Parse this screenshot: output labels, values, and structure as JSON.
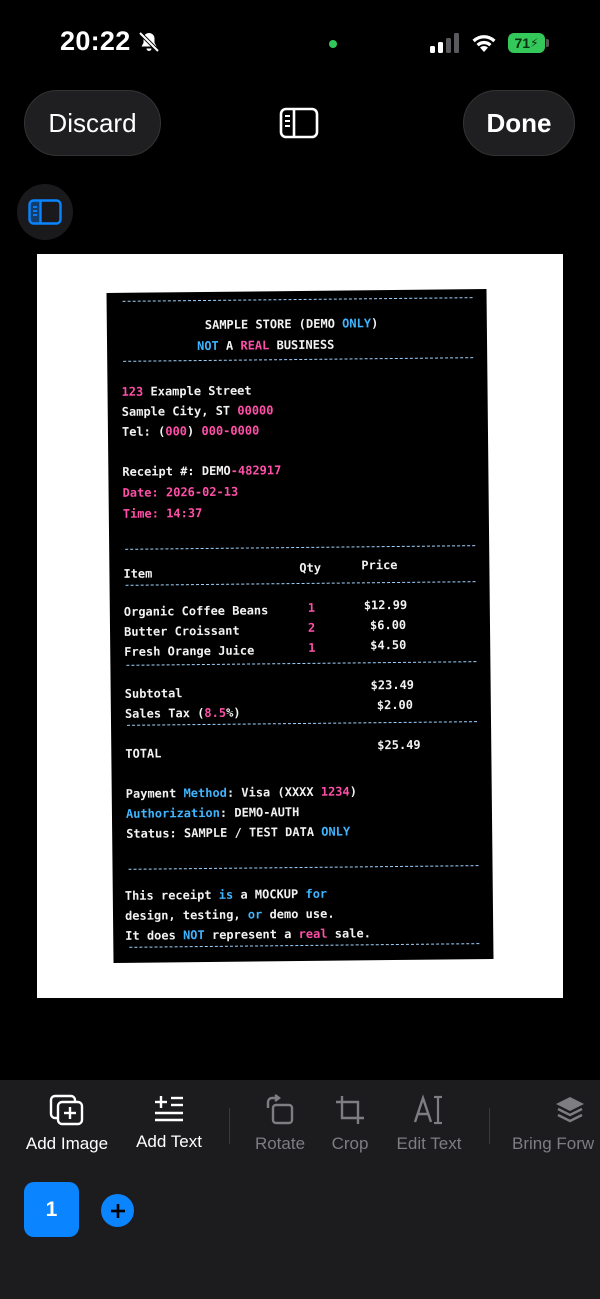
{
  "status": {
    "time": "20:22",
    "battery": "71"
  },
  "header": {
    "discard_label": "Discard",
    "done_label": "Done"
  },
  "receipt": {
    "lines": {
      "store_a": "SAMPLE STORE (DEMO ",
      "store_b": "ONLY",
      "store_c": ")",
      "notice_a": "NOT",
      "notice_b": " A ",
      "notice_c": "REAL",
      "notice_d": " BUSINESS",
      "addr_num": "123",
      "addr_street": " Example Street",
      "city": "Sample City, ST ",
      "zip": "00000",
      "tel_a": "Tel: (",
      "tel_b": "000",
      "tel_c": ") ",
      "tel_d": "000-0000",
      "receipt_a": "Receipt #: DEMO",
      "receipt_b": "-482917",
      "date_a": "Date",
      "date_b": ": 2026-02-13",
      "time_a": "Time",
      "time_b": ": 14",
      "time_c": ":37",
      "col_item": "Item",
      "col_qty": "Qty",
      "col_price": "Price",
      "subtotal": "Subtotal",
      "subtotal_val": "$23.49",
      "tax_a": "Sales Tax (",
      "tax_b": "8.5",
      "tax_c": "%)",
      "tax_val": "$2.00",
      "total": "TOTAL",
      "total_val": "$25.49",
      "pay_a": "Payment ",
      "pay_b": "Method",
      "pay_c": ": Visa (XXXX ",
      "pay_d": "1234",
      "pay_e": ")",
      "auth_a": "Authorization",
      "auth_b": ": DEMO-AUTH",
      "stat_a": "Status: SAMPLE / TEST DATA ",
      "stat_b": "ONLY",
      "foot1_a": "This receipt ",
      "foot1_b": "is",
      "foot1_c": " a MOCKUP ",
      "foot1_d": "for",
      "foot2_a": "design, testing, ",
      "foot2_b": "or",
      "foot2_c": " demo use.",
      "foot3_a": "It does ",
      "foot3_b": "NOT",
      "foot3_c": " represent a ",
      "foot3_d": "real",
      "foot3_e": " sale."
    },
    "items": [
      {
        "name": "Organic Coffee Beans",
        "qty": "1",
        "price": "$12.99"
      },
      {
        "name": "Butter Croissant",
        "qty": "2",
        "price": "$6.00"
      },
      {
        "name": "Fresh Orange Juice",
        "qty": "1",
        "price": "$4.50"
      }
    ]
  },
  "toolbar": {
    "add_image": "Add Image",
    "add_text": "Add Text",
    "rotate": "Rotate",
    "crop": "Crop",
    "edit_text": "Edit Text",
    "bring_forward": "Bring Forw"
  },
  "pages": {
    "current": "1"
  },
  "colors": {
    "accent": "#0a84ff",
    "receipt_pink": "#ff4fa8",
    "receipt_blue": "#3fb4ff",
    "battery": "#34c759"
  },
  "icons": [
    "bell-slash-icon",
    "signal-icon",
    "wifi-icon",
    "battery-icon",
    "sidebar-icon",
    "add-image-icon",
    "add-text-icon",
    "rotate-icon",
    "crop-icon",
    "edit-text-icon",
    "layers-icon",
    "plus-icon"
  ]
}
